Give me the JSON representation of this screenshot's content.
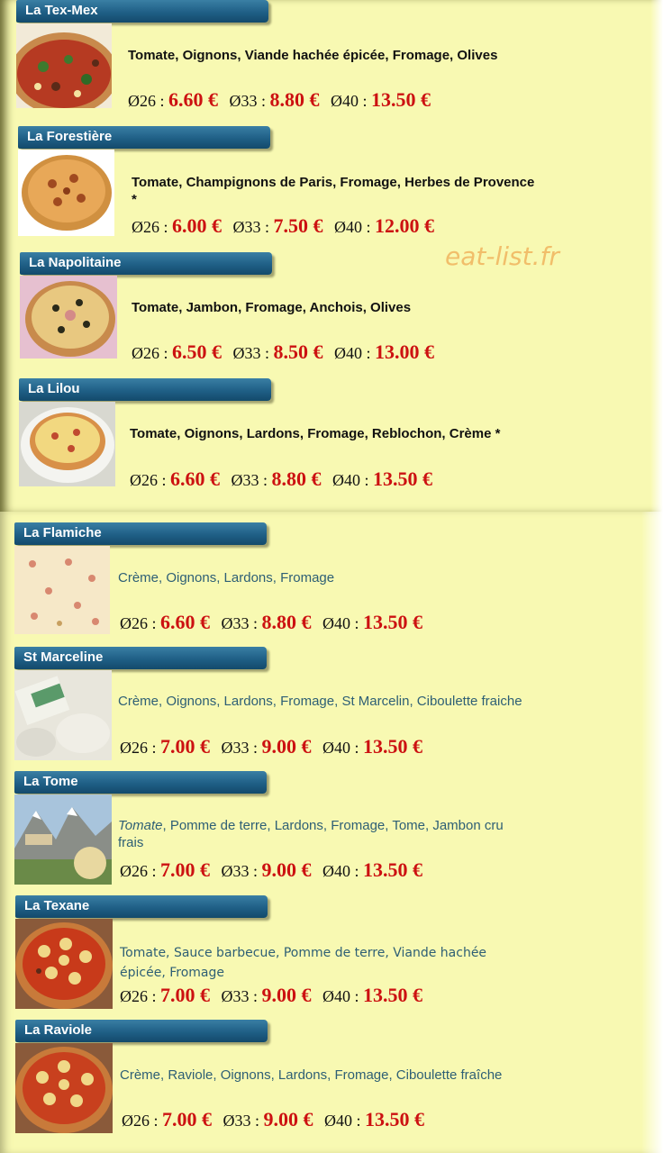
{
  "watermark": "eat-list.fr",
  "pizzas": [
    {
      "name": "La Tex-Mex",
      "desc": "Tomate, Oignons, Viande hachée épicée, Fromage, Olives",
      "p26": "6.60 €",
      "p33": "8.80 €",
      "p40": "13.50 €"
    },
    {
      "name": "La Forestière",
      "desc": "Tomate, Champignons de Paris, Fromage, Herbes de Provence *",
      "p26": "6.00 €",
      "p33": "7.50 €",
      "p40": "12.00 €"
    },
    {
      "name": "La Napolitaine",
      "desc": "Tomate, Jambon, Fromage, Anchois, Olives",
      "p26": "6.50 €",
      "p33": "8.50 €",
      "p40": "13.00 €"
    },
    {
      "name": "La Lilou",
      "desc": "Tomate, Oignons, Lardons, Fromage, Reblochon, Crème *",
      "p26": "6.60 €",
      "p33": "8.80 €",
      "p40": "13.50 €"
    },
    {
      "name": "La Flamiche",
      "desc": "Crème, Oignons, Lardons, Fromage",
      "p26": "6.60 €",
      "p33": "8.80 €",
      "p40": "13.50 €"
    },
    {
      "name": "St Marceline",
      "desc": "Crème, Oignons, Lardons, Fromage, St Marcelin, Ciboulette fraiche",
      "p26": "7.00 €",
      "p33": "9.00 €",
      "p40": "13.50 €"
    },
    {
      "name": "La Tome",
      "desc_italic": "Tomate",
      "desc": ", Pomme de terre, Lardons, Fromage, Tome, Jambon cru frais",
      "p26": "7.00 €",
      "p33": "9.00 €",
      "p40": "13.50 €"
    },
    {
      "name": "La Texane",
      "desc": "Tomate, Sauce barbecue, Pomme de terre, Viande hachée épicée, Fromage",
      "p26": "7.00 €",
      "p33": "9.00 €",
      "p40": "13.50 €"
    },
    {
      "name": "La Raviole",
      "desc": "Crème, Raviole, Oignons, Lardons, Fromage, Ciboulette fraîche",
      "p26": "7.00 €",
      "p33": "9.00 €",
      "p40": "13.50 €"
    }
  ],
  "size_labels": {
    "s26": "Ø26 :",
    "s33": "Ø33 :",
    "s40": "Ø40 :"
  }
}
